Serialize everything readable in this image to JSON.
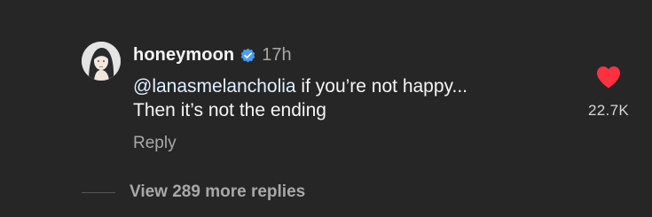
{
  "colors": {
    "background": "#262626",
    "text_primary": "#f5f5f5",
    "text_secondary": "#a8a8a8",
    "verified_blue": "#4a9df8",
    "heart_red": "#ff3040"
  },
  "comment": {
    "username": "honeymoon",
    "verified": true,
    "verified_icon": "verified-badge-icon",
    "timestamp": "17h",
    "mention": "@lanasmelancholia",
    "text_line1": " if you’re not happy...",
    "text_line2": "Then it’s not the ending",
    "reply_label": "Reply",
    "liked": true,
    "like_icon": "heart-icon",
    "like_count": "22.7K"
  },
  "replies": {
    "view_more_label": "View 289 more replies"
  }
}
